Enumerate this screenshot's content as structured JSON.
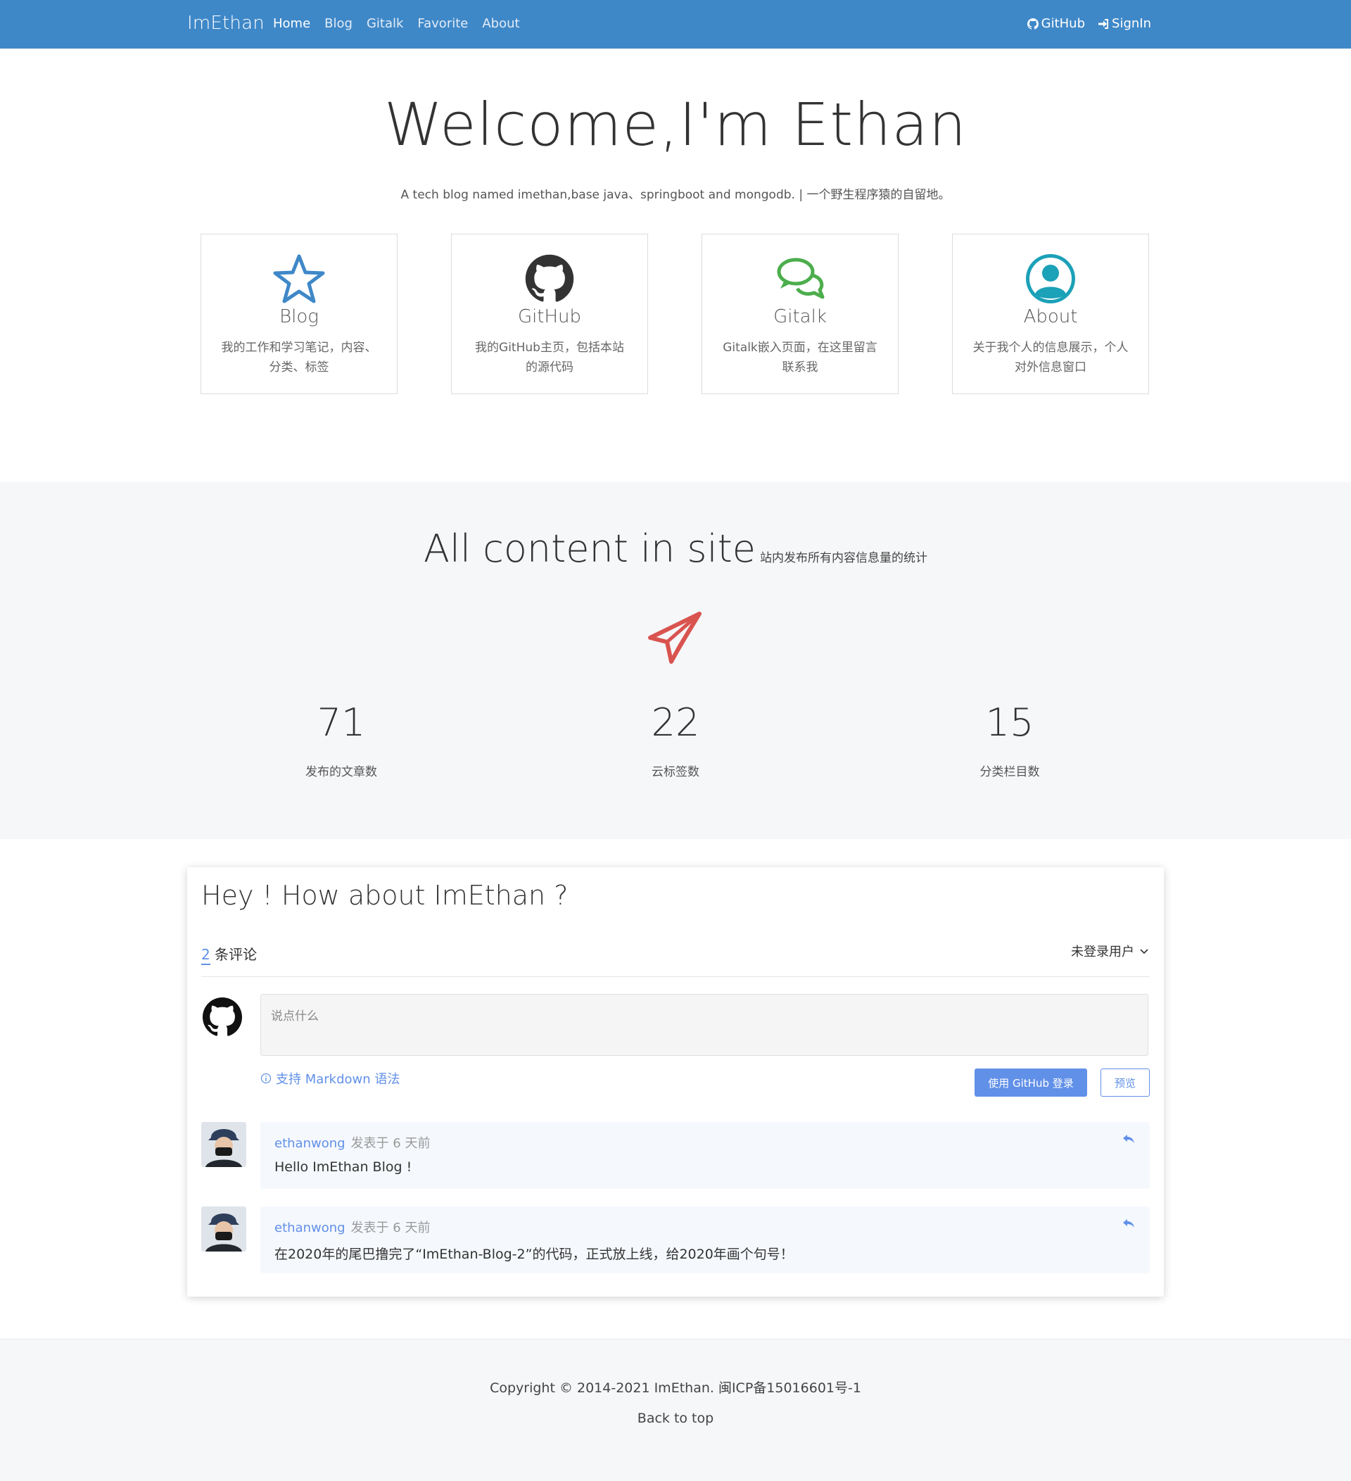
{
  "nav": {
    "brand": "ImEthan",
    "links": [
      "Home",
      "Blog",
      "Gitalk",
      "Favorite",
      "About"
    ],
    "right": [
      "GitHub",
      "SignIn"
    ]
  },
  "hero": {
    "title": "Welcome,I'm Ethan",
    "subtitle": "A tech blog named imethan,base java、springboot and mongodb. | 一个野生程序猿的自留地。"
  },
  "cards": [
    {
      "title": "Blog",
      "desc_l1": "我的工作和学习笔记，内容、",
      "desc_l2": "分类、标签",
      "icon": "star-icon",
      "color": "#3f88c8"
    },
    {
      "title": "GitHub",
      "desc_l1": "我的GitHub主页，包括本站",
      "desc_l2": "的源代码",
      "icon": "github-icon",
      "color": "#333333"
    },
    {
      "title": "Gitalk",
      "desc_l1": "Gitalk嵌入页面，在这里留言",
      "desc_l2": "联系我",
      "icon": "comments-icon",
      "color": "#4cae4c"
    },
    {
      "title": "About",
      "desc_l1": "关于我个人的信息展示，个人",
      "desc_l2": "对外信息窗口",
      "icon": "user-circle-icon",
      "color": "#1ba1b8"
    }
  ],
  "stats": {
    "title": "All content in site",
    "subtitle": "站内发布所有内容信息量的统计",
    "icon": "paper-plane-icon",
    "items": [
      {
        "num": "71",
        "label": "发布的文章数"
      },
      {
        "num": "22",
        "label": "云标签数"
      },
      {
        "num": "15",
        "label": "分类栏目数"
      }
    ]
  },
  "gitalk": {
    "title": "Hey ! How about ImEthan ?",
    "count": "2",
    "count_label": " 条评论",
    "user": "未登录用户",
    "placeholder": "说点什么",
    "markdown": "支持 Markdown 语法",
    "login_button": "使用 GitHub 登录",
    "preview_button": "预览",
    "comments": [
      {
        "author": "ethanwong",
        "meta": "发表于  6 天前",
        "text": "Hello ImEthan Blog !"
      },
      {
        "author": "ethanwong",
        "meta": "发表于  6 天前",
        "text": "在2020年的尾巴撸完了“ImEthan-Blog-2”的代码，正式放上线，给2020年画个句号！"
      }
    ]
  },
  "footer": {
    "copyright": "Copyright © 2014-2021 ImEthan. 闽ICP备15016601号-1",
    "back_to_top": "Back to top"
  },
  "colors": {
    "nav": "#3f88c8",
    "accent": "#6190e8",
    "plane": "#d9534f"
  }
}
